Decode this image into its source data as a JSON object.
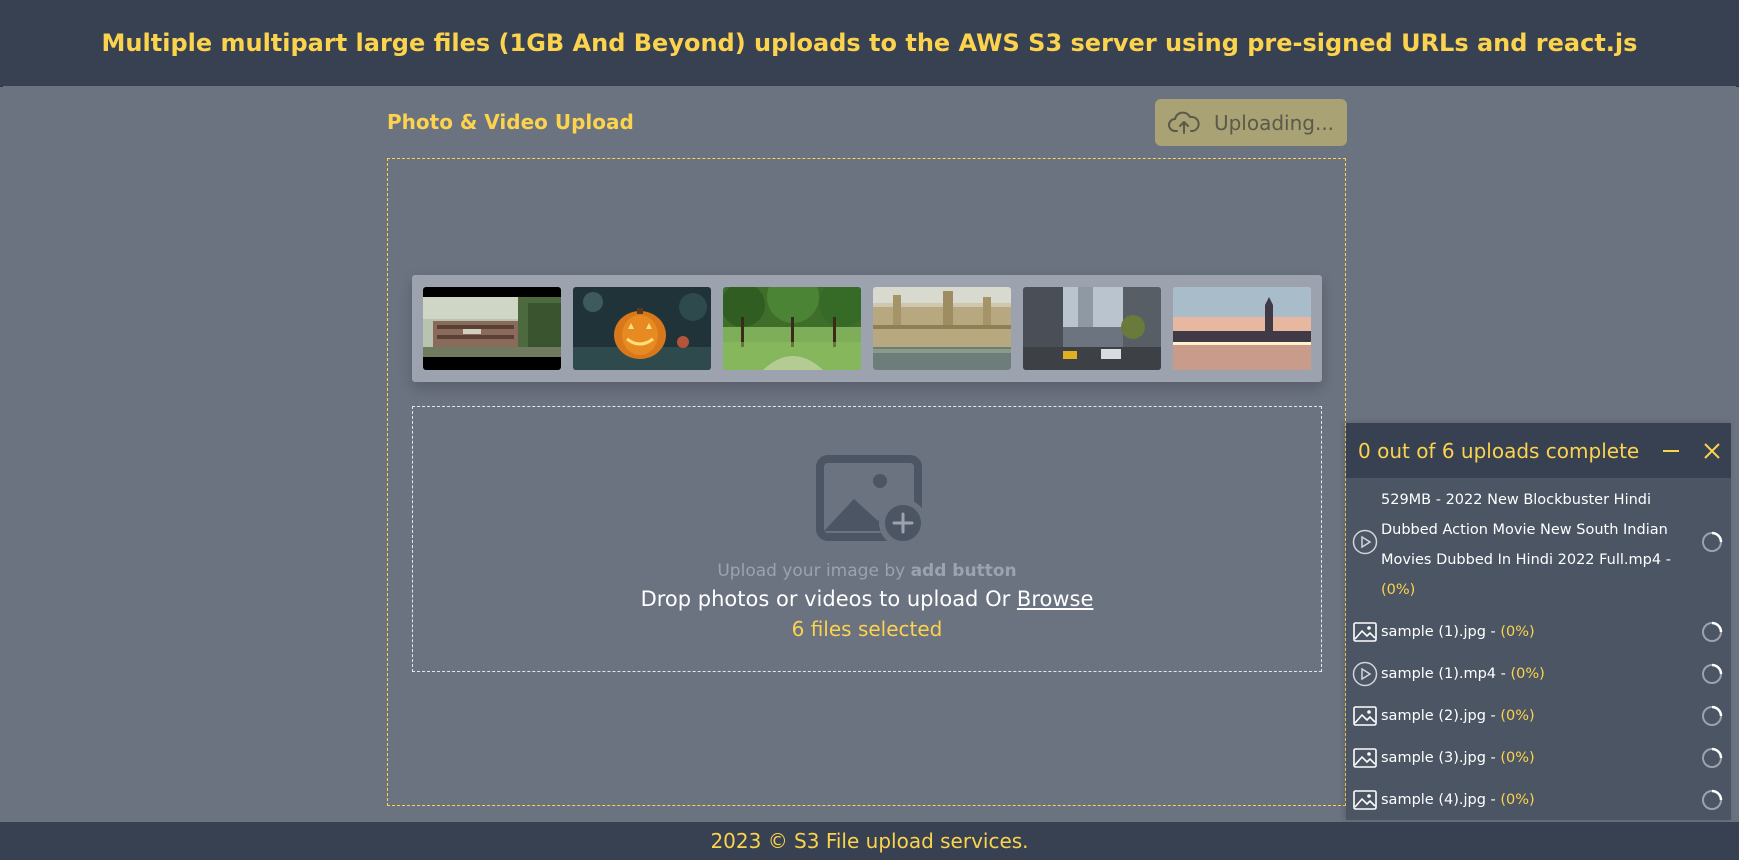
{
  "header": {
    "title": "Multiple multipart large files (1GB And Beyond) uploads to the AWS S3 server using pre-signed URLs and react.js"
  },
  "section": {
    "title": "Photo & Video Upload"
  },
  "upload_button": {
    "label": "Uploading...",
    "icon": "cloud-upload-icon"
  },
  "thumbnails": [
    {
      "name": "video-thumbnail-building"
    },
    {
      "name": "image-thumbnail-pumpkin"
    },
    {
      "name": "image-thumbnail-park"
    },
    {
      "name": "image-thumbnail-parliament"
    },
    {
      "name": "image-thumbnail-street"
    },
    {
      "name": "image-thumbnail-bigben"
    }
  ],
  "drop_zone": {
    "hint_prefix": "Upload your image by",
    "hint_bold": "add button",
    "text": "Drop photos or videos to upload Or",
    "browse": "Browse",
    "selected": "6 files selected"
  },
  "upload_panel": {
    "title": "0 out of 6 uploads complete",
    "items": [
      {
        "type": "video",
        "name_line1": "529MB - 2022 New Blockbuster Hindi",
        "name_line2": "Dubbed Action Movie New South Indian",
        "name_line3": "Movies Dubbed In Hindi 2022 Full.mp4 -",
        "progress": "(0%)"
      },
      {
        "type": "image",
        "name": "sample (1).jpg -",
        "progress": "(0%)"
      },
      {
        "type": "video",
        "name": "sample (1).mp4 -",
        "progress": "(0%)"
      },
      {
        "type": "image",
        "name": "sample (2).jpg -",
        "progress": "(0%)"
      },
      {
        "type": "image",
        "name": "sample (3).jpg -",
        "progress": "(0%)"
      },
      {
        "type": "image",
        "name": "sample (4).jpg -",
        "progress": "(0%)"
      }
    ]
  },
  "footer": {
    "text": "2023 © S3 File upload services."
  },
  "colors": {
    "accent": "#fcd34d",
    "header_bg": "#374151",
    "body_bg": "#6b7280",
    "panel_bg": "#4b5563"
  }
}
